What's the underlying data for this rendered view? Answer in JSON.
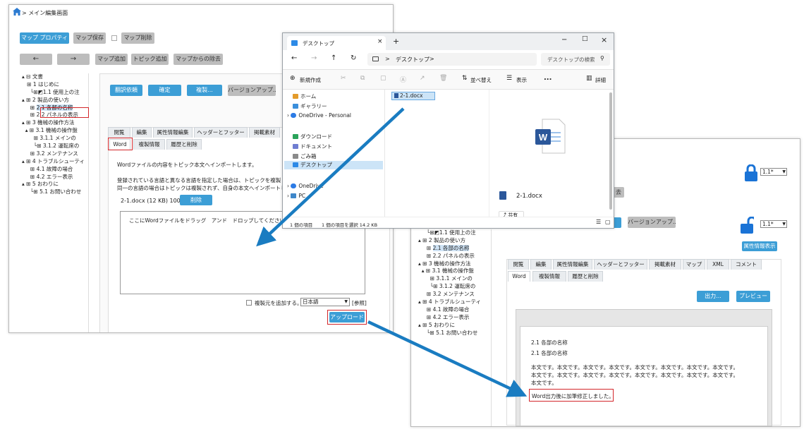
{
  "left": {
    "breadcrumb": "> メイン編集画面",
    "btn_map_prop": "マップ プロパティ",
    "btn_map_save": "マップ保存",
    "btn_map_delete": "マップ削除",
    "btn_back": "←",
    "btn_forward": "→",
    "btn_map_add": "マップ追加",
    "btn_topic_add": "トピック追加",
    "btn_map_remove": "マップからの除去",
    "tree": [
      "文書",
      "1 はじめに",
      "1.1 使用上の注",
      "2 製品の使い方",
      "2.1 各部の名称",
      "2.2 パネルの表示",
      "3 機械の操作方法",
      "3.1 機械の操作盤",
      "3.1.1 メインの",
      "3.1.2 運転席の",
      "3.2 メンテナンス",
      "4 トラブルシューティ",
      "4.1 故障の場合",
      "4.2 エラー表示",
      "5 おわりに",
      "5.1 お問い合わせ"
    ],
    "btn_translate": "翻訳依頼",
    "btn_confirm": "確定",
    "btn_copy": "複製...",
    "btn_version": "バージョンアップ...",
    "tabs1": [
      "閲覧",
      "編集",
      "属性情報編集",
      "ヘッダーとフッター",
      "掲載素材"
    ],
    "tabs2": [
      "Word",
      "複製情報",
      "履歴と削除"
    ],
    "desc1": "Wordファイルの内容をトピック本文へインポートします。",
    "desc2": "登録されている言語と異なる言語を指定した場合は、トピックを複製して",
    "desc3": "同一の言語の場合はトピックは複製されず、自身の本文へインポートしま",
    "file_info": "2-1.docx (12 KB) 100%",
    "btn_delete": "削除",
    "drop_text": "ここにWordファイルをドラッグ　アンド　ドロップしてください",
    "checkbox_label": "複製元を追加する。",
    "language": "日本語",
    "ref": "[参照]",
    "btn_upload": "アップロード"
  },
  "explorer": {
    "tab_title": "デスクトップ",
    "new_tab": "+",
    "path": "デスクトップ",
    "path_sep": ">",
    "search_placeholder": "デスクトップの検索",
    "btn_new": "新規作成",
    "btn_sort": "並べ替え",
    "btn_view": "表示",
    "btn_more": "...",
    "btn_details": "詳細",
    "nav": [
      "ホーム",
      "ギャラリー",
      "OneDrive - Personal",
      "ダウンロード",
      "ドキュメント",
      "ごみ箱",
      "デスクトップ",
      "OneDrive",
      "PC"
    ],
    "file_name": "2-1.docx",
    "preview_name": "2-1.docx",
    "share": "共有",
    "status_count": "1 個の項目",
    "status_selected": "1 個の項目を選択  14.2 KB"
  },
  "right": {
    "version1": "1.1*",
    "version2": "1.1*",
    "btn_hidden": "去",
    "btn_version": "バージョンアップ...",
    "btn_attr": "属性情報表示",
    "tree": [
      "1.1 使用上の注",
      "2 製品の使い方",
      "2.1 各部の名称",
      "2.2 パネルの表示",
      "3 機械の操作方法",
      "3.1 機械の操作盤",
      "3.1.1 メインの",
      "3.1.2 運転席の",
      "3.2 メンテナンス",
      "4 トラブルシューティ",
      "4.1 故障の場合",
      "4.2 エラー表示",
      "5 おわりに",
      "5.1 お問い合わせ"
    ],
    "tabs1": [
      "閲覧",
      "編集",
      "属性情報編集",
      "ヘッダーとフッター",
      "掲載素材",
      "マップ",
      "XML",
      "コメント"
    ],
    "tabs2": [
      "Word",
      "複製情報",
      "履歴と削除"
    ],
    "btn_output": "出力...",
    "btn_preview": "プレビュー",
    "heading1": "2.1 各部の名称",
    "heading2": "2.1 各部の名称",
    "body_lines": [
      "本文です。本文です。本文です。本文です。本文です。本文です。本文です。本文です。",
      "本文です。本文です。本文です。本文です。本文です。本文です。本文です。本文です。",
      "本文です。"
    ],
    "added_text": "Word出力後に加筆修正しました。"
  },
  "colors": {
    "accent": "#3c9ed6",
    "highlight": "#d3272b",
    "arrow": "#1a7cc1"
  }
}
